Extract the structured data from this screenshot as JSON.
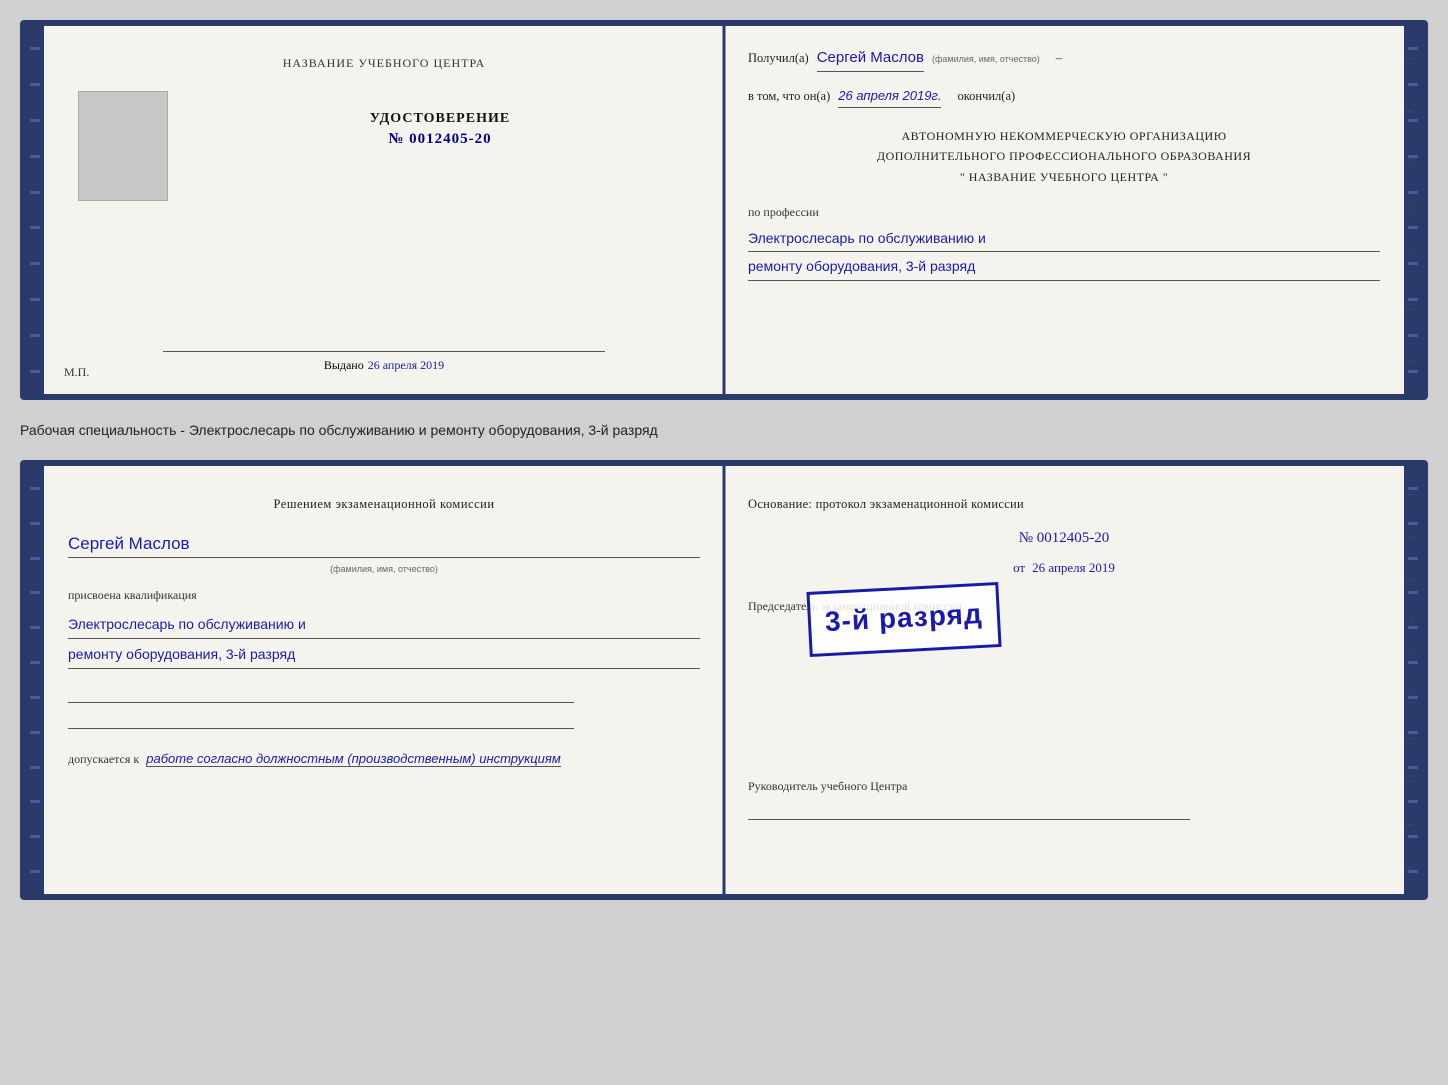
{
  "topDoc": {
    "left": {
      "centerTitle": "НАЗВАНИЕ УЧЕБНОГО ЦЕНТРА",
      "photoAlt": "фото",
      "certTitle": "УДОСТОВЕРЕНИЕ",
      "certNumber": "№ 0012405-20",
      "issuedLabel": "Выдано",
      "issuedDate": "26 апреля 2019",
      "mpLabel": "М.П."
    },
    "right": {
      "recipientLabel": "Получил(а)",
      "recipientName": "Сергей Маслов",
      "recipientHint": "(фамилия, имя, отчество)",
      "dashAfterName": "–",
      "inThatLabel": "в том, что он(а)",
      "inThatDate": "26 апреля 2019г.",
      "completedLabel": "окончил(а)",
      "orgLine1": "АВТОНОМНУЮ НЕКОММЕРЧЕСКУЮ ОРГАНИЗАЦИЮ",
      "orgLine2": "ДОПОЛНИТЕЛЬНОГО ПРОФЕССИОНАЛЬНОГО ОБРАЗОВАНИЯ",
      "orgLine3": "\"   НАЗВАНИЕ УЧЕБНОГО ЦЕНТРА   \"",
      "professionLabel": "по профессии",
      "professionLine1": "Электрослесарь по обслуживанию и",
      "professionLine2": "ремонту оборудования, 3-й разряд"
    }
  },
  "middleLabel": "Рабочая специальность - Электрослесарь по обслуживанию и ремонту оборудования, 3-й разряд",
  "bottomDoc": {
    "left": {
      "commissionTitle": "Решением экзаменационной комиссии",
      "personName": "Сергей Маслов",
      "personHint": "(фамилия, имя, отчество)",
      "qualificationLabel": "присвоена квалификация",
      "qualLine1": "Электрослесарь по обслуживанию и",
      "qualLine2": "ремонту оборудования, 3-й разряд",
      "допускаетсяPrefix": "допускается к",
      "допускаетсяText": "работе согласно должностным (производственным) инструкциям"
    },
    "right": {
      "osnovaTitle": "Основание: протокол экзаменационной комиссии",
      "protocolNumber": "№  0012405-20",
      "datePrefix": "от",
      "dateValue": "26 апреля 2019",
      "chairmanLabel": "Председатель экзаменационной комиссии",
      "stampText": "3-й разряд",
      "rukovoditelLabel": "Руководитель учебного Центра"
    }
  },
  "sideDecorations": {
    "letters": "и\nа\n←\n–\n–\n–\n–"
  }
}
